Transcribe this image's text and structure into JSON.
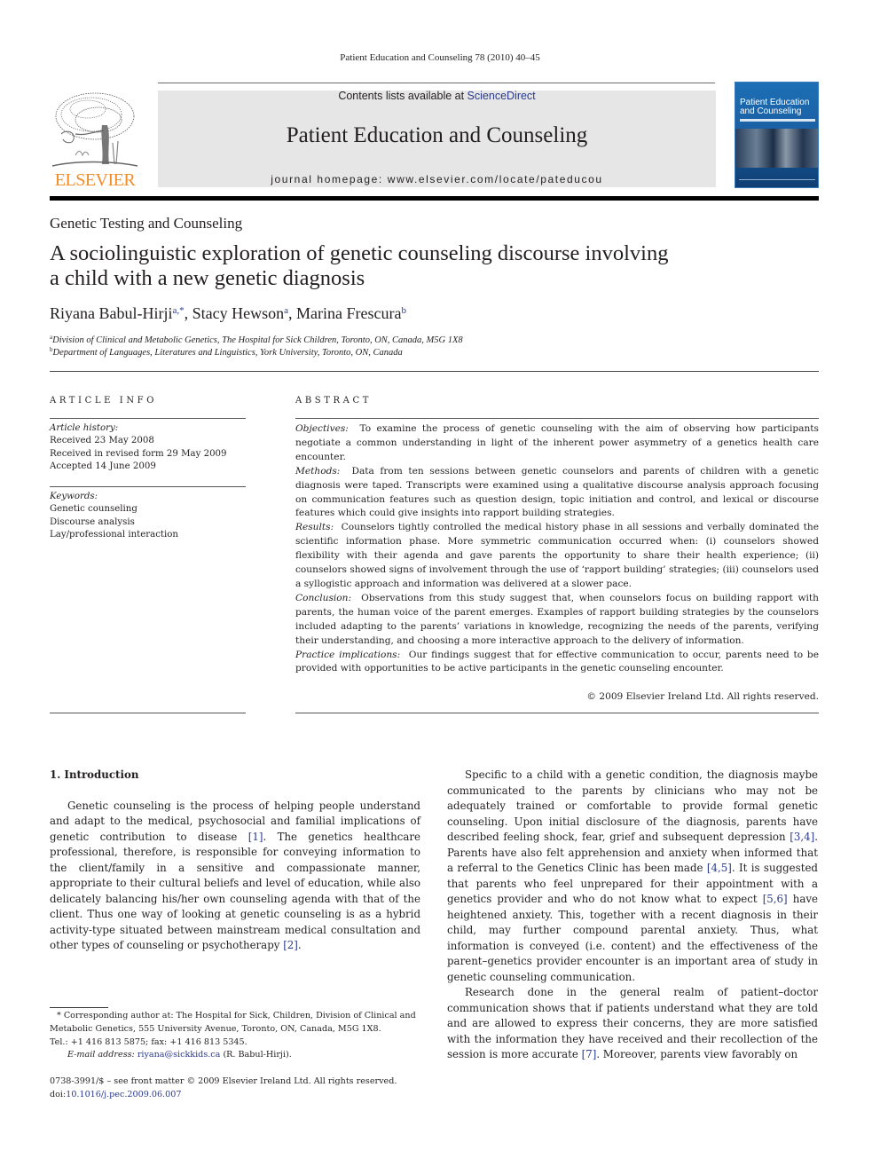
{
  "running_header": "Patient Education and Counseling 78 (2010) 40–45",
  "masthead": {
    "publisher_logo": "elsevier-tree-logo",
    "publisher_name": "ELSEVIER",
    "contents_prefix": "Contents lists available at ",
    "contents_link": "ScienceDirect",
    "journal_title": "Patient Education and Counseling",
    "homepage": "journal homepage: www.elsevier.com/locate/pateducou",
    "cover_title_line1": "Patient Education",
    "cover_title_line2": "and Counseling"
  },
  "section_label": "Genetic Testing and Counseling",
  "title": {
    "line1": "A sociolinguistic exploration of genetic counseling discourse involving",
    "line2": "a child with a new genetic diagnosis"
  },
  "authors": [
    {
      "name": "Riyana Babul-Hirji",
      "sup": "a,*",
      "sep": ", "
    },
    {
      "name": "Stacy Hewson",
      "sup": "a",
      "sep": ", "
    },
    {
      "name": "Marina Frescura",
      "sup": "b",
      "sep": ""
    }
  ],
  "affiliations": [
    {
      "mark": "a",
      "text": "Division of Clinical and Metabolic Genetics, The Hospital for Sick Children, Toronto, ON, Canada, M5G 1X8"
    },
    {
      "mark": "b",
      "text": "Department of Languages, Literatures and Linguistics, York University, Toronto, ON, Canada"
    }
  ],
  "article_info": {
    "heading": "ARTICLE INFO",
    "history_label": "Article history:",
    "history": [
      "Received 23 May 2008",
      "Received in revised form 29 May 2009",
      "Accepted 14 June 2009"
    ],
    "keywords_label": "Keywords:",
    "keywords": [
      "Genetic counseling",
      "Discourse analysis",
      "Lay/professional interaction"
    ]
  },
  "abstract": {
    "heading": "ABSTRACT",
    "sections": [
      {
        "label": "Objectives:",
        "text": "To examine the process of genetic counseling with the aim of observing how participants negotiate a common understanding in light of the inherent power asymmetry of a genetics health care encounter."
      },
      {
        "label": "Methods:",
        "text": "Data from ten sessions between genetic counselors and parents of children with a genetic diagnosis were taped. Transcripts were examined using a qualitative discourse analysis approach focusing on communication features such as question design, topic initiation and control, and lexical or discourse features which could give insights into rapport building strategies."
      },
      {
        "label": "Results:",
        "text": "Counselors tightly controlled the medical history phase in all sessions and verbally dominated the scientific information phase. More symmetric communication occurred when: (i) counselors showed flexibility with their agenda and gave parents the opportunity to share their health experience; (ii) counselors showed signs of involvement through the use of ‘rapport building’ strategies; (iii) counselors used a syllogistic approach and information was delivered at a slower pace."
      },
      {
        "label": "Conclusion:",
        "text": "Observations from this study suggest that, when counselors focus on building rapport with parents, the human voice of the parent emerges. Examples of rapport building strategies by the counselors included adapting to the parents’ variations in knowledge, recognizing the needs of the parents, verifying their understanding, and choosing a more interactive approach to the delivery of information."
      },
      {
        "label": "Practice implications:",
        "text": "Our findings suggest that for effective communication to occur, parents need to be provided with opportunities to be active participants in the genetic counseling encounter."
      }
    ],
    "copyright": "© 2009 Elsevier Ireland Ltd. All rights reserved."
  },
  "body": {
    "intro_heading": "1.  Introduction",
    "left_para": {
      "p1": "Genetic counseling is the process of helping people understand and adapt to the medical, psychosocial and familial implications of genetic contribution to disease ",
      "ref1": "[1]",
      "p2": ". The genetics healthcare professional, therefore, is responsible for conveying information to the client/family in a sensitive and compassionate manner, appropriate to their cultural beliefs and level of education, while also delicately balancing his/her own counseling agenda with that of the client. Thus one way of looking at genetic counseling is as a hybrid activity-type situated between mainstream medical consultation and other types of counseling or psychotherapy ",
      "ref2": "[2]",
      "p3": "."
    },
    "right_para1": {
      "t1": "Specific to a child with a genetic condition, the diagnosis maybe communicated to the parents by clinicians who may not be adequately trained or comfortable to provide formal genetic counseling. Upon initial disclosure of the diagnosis, parents have described feeling shock, fear, grief and subsequent depression ",
      "r1": "[3,4]",
      "t2": ". Parents have also felt apprehension and anxiety when informed that a referral to the Genetics Clinic has been made ",
      "r2": "[4,5]",
      "t3": ". It is suggested that parents who feel unprepared for their appointment with a genetics provider and who do not know what to expect ",
      "r3": "[5,6]",
      "t4": " have heightened anxiety. This, together with a recent diagnosis in their child, may further compound parental anxiety. Thus, what information is conveyed (i.e. content) and the effectiveness of the parent–genetics provider encounter is an important area of study in genetic counseling communication."
    },
    "right_para2": {
      "t1": "Research done in the general realm of patient–doctor communication shows that if patients understand what they are told and are allowed to express their concerns, they are more satisfied with the information they have received and their recollection of the session is more accurate ",
      "r1": "[7]",
      "t2": ". Moreover, parents view favorably on"
    }
  },
  "footnotes": {
    "corresponding": "* Corresponding author at: The Hospital for Sick, Children, Division of Clinical and Metabolic Genetics, 555 University Avenue, Toronto, ON, Canada, M5G 1X8.",
    "tel": "Tel.: +1 416 813 5875; fax: +1 416 813 5345.",
    "email_label": "E-mail address: ",
    "email": "riyana@sickkids.ca",
    "email_suffix": " (R. Babul-Hirji).",
    "front_matter": "0738-3991/$ – see front matter © 2009 Elsevier Ireland Ltd. All rights reserved.",
    "doi_prefix": "doi:",
    "doi": "10.1016/j.pec.2009.06.007"
  },
  "colors": {
    "link": "#2b3a8c",
    "elsevier_orange": "#f28c28",
    "masthead_gray": "#e6e6e6",
    "cover_blue": "#1d6fb5"
  }
}
